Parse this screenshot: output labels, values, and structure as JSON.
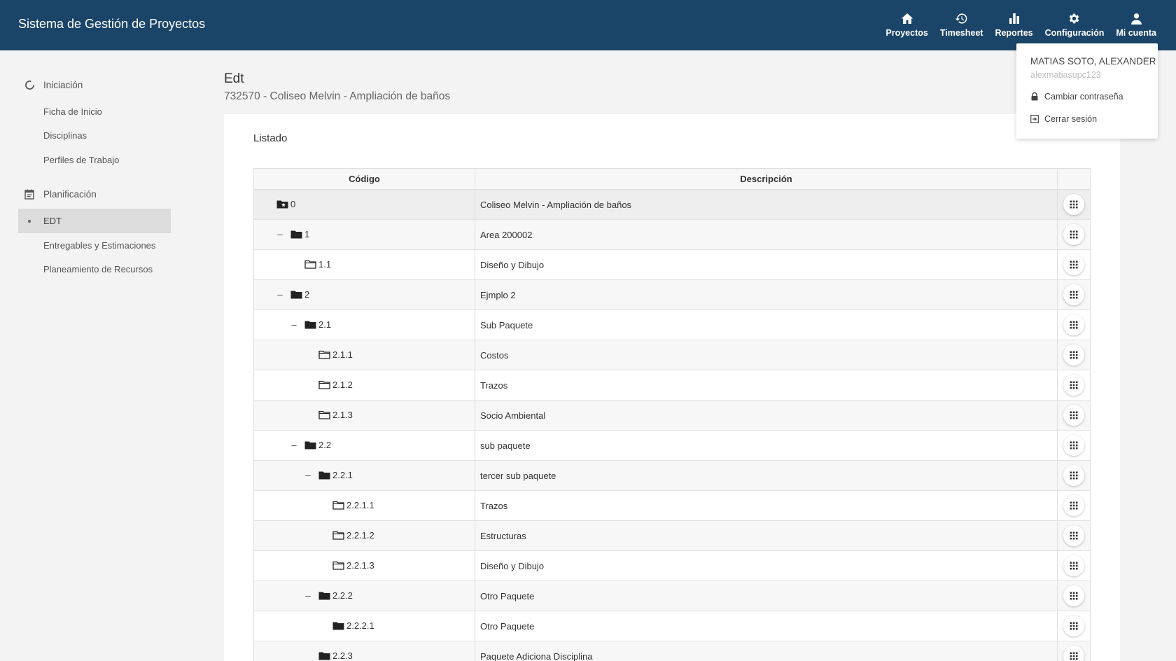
{
  "app": {
    "title": "Sistema de Gestión de Proyectos"
  },
  "nav": [
    {
      "label": "Proyectos",
      "icon": "home-icon"
    },
    {
      "label": "Timesheet",
      "icon": "history-icon"
    },
    {
      "label": "Reportes",
      "icon": "bar-chart-icon"
    },
    {
      "label": "Configuración",
      "icon": "gear-icon"
    },
    {
      "label": "Mi cuenta",
      "icon": "user-icon"
    }
  ],
  "sidebar": {
    "sections": [
      {
        "label": "Iniciación",
        "items": [
          "Ficha de Inicio",
          "Disciplinas",
          "Perfiles de Trabajo"
        ]
      },
      {
        "label": "Planificación",
        "items": [
          "EDT",
          "Entregables y Estimaciones",
          "Planeamiento de Recursos"
        ],
        "active": "EDT"
      }
    ]
  },
  "page": {
    "title": "Edt",
    "subtitle": "732570 - Coliseo Melvin - Ampliación de baños"
  },
  "card": {
    "title": "Listado"
  },
  "grid": {
    "headers": {
      "code": "Código",
      "description": "Descripción"
    },
    "rows": [
      {
        "code": "0",
        "description": "Coliseo Melvin - Ampliación de baños",
        "level": 0,
        "toggle": "",
        "folder": "root"
      },
      {
        "code": "1",
        "description": "Area 200002",
        "level": 1,
        "toggle": "–",
        "folder": "filled"
      },
      {
        "code": "1.1",
        "description": "Diseño y Dibujo",
        "level": 2,
        "toggle": "",
        "folder": "outline"
      },
      {
        "code": "2",
        "description": "Ejmplo 2",
        "level": 1,
        "toggle": "–",
        "folder": "filled"
      },
      {
        "code": "2.1",
        "description": "Sub Paquete",
        "level": 2,
        "toggle": "–",
        "folder": "filled"
      },
      {
        "code": "2.1.1",
        "description": "Costos",
        "level": 3,
        "toggle": "",
        "folder": "outline"
      },
      {
        "code": "2.1.2",
        "description": "Trazos",
        "level": 3,
        "toggle": "",
        "folder": "outline"
      },
      {
        "code": "2.1.3",
        "description": "Socio Ambiental",
        "level": 3,
        "toggle": "",
        "folder": "outline"
      },
      {
        "code": "2.2",
        "description": "sub paquete",
        "level": 2,
        "toggle": "–",
        "folder": "filled"
      },
      {
        "code": "2.2.1",
        "description": "tercer sub paquete",
        "level": 3,
        "toggle": "–",
        "folder": "filled"
      },
      {
        "code": "2.2.1.1",
        "description": "Trazos",
        "level": 4,
        "toggle": "",
        "folder": "outline"
      },
      {
        "code": "2.2.1.2",
        "description": "Estructuras",
        "level": 4,
        "toggle": "",
        "folder": "outline"
      },
      {
        "code": "2.2.1.3",
        "description": "Diseño y Dibujo",
        "level": 4,
        "toggle": "",
        "folder": "outline"
      },
      {
        "code": "2.2.2",
        "description": "Otro Paquete",
        "level": 3,
        "toggle": "–",
        "folder": "filled"
      },
      {
        "code": "2.2.2.1",
        "description": "Otro Paquete",
        "level": 4,
        "toggle": "",
        "folder": "filled"
      },
      {
        "code": "2.2.3",
        "description": "Paquete Adiciona Disciplina",
        "level": 3,
        "toggle": "",
        "folder": "filled"
      }
    ]
  },
  "account_menu": {
    "name": "MATIAS SOTO, ALEXANDER",
    "username": "alexmatiasupc123",
    "items": [
      {
        "label": "Cambiar contraseña",
        "icon": "lock-icon"
      },
      {
        "label": "Cerrar sesión",
        "icon": "logout-icon"
      }
    ]
  },
  "colors": {
    "topbar": "#1b4568",
    "background": "#f3f3f3",
    "active_item": "#dcdcdc"
  }
}
